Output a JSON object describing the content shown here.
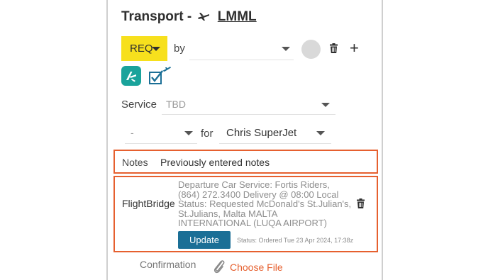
{
  "header": {
    "title_prefix": "Transport -",
    "airport_code": "LMML"
  },
  "request": {
    "status_label": "REQ",
    "by_label": "by",
    "by_value": ""
  },
  "service": {
    "label": "Service",
    "value": "TBD"
  },
  "assignment": {
    "count_value": "-",
    "for_label": "for",
    "pilot_value": "Chris SuperJet"
  },
  "notes": {
    "label": "Notes",
    "value": "Previously entered notes"
  },
  "flightbridge": {
    "label": "FlightBridge",
    "details": "Departure Car Service: Fortis Riders, (864) 272.3400 Delivery @ 08:00 Local Status: Requested McDonald's St.Julian's, St.Julians, Malta MALTA INTERNATIONAL (LUQA AIRPORT)",
    "update_label": "Update",
    "status": "Status: Ordered Tue 23 Apr 2024, 17:38z"
  },
  "confirmation": {
    "label": "Confirmation",
    "choose_file_label": "Choose File"
  },
  "icons": {
    "plane": "airplane-icon",
    "trash": "trash-icon",
    "plus": "plus-icon",
    "logo": "flightbridge-logo-icon",
    "check_plane": "checkbox-plane-icon",
    "paperclip": "paperclip-icon"
  },
  "colors": {
    "req_yellow": "#f7e01d",
    "highlight_orange": "#e6602f",
    "update_blue": "#1b6f96",
    "logo_teal": "#1aa39b"
  }
}
